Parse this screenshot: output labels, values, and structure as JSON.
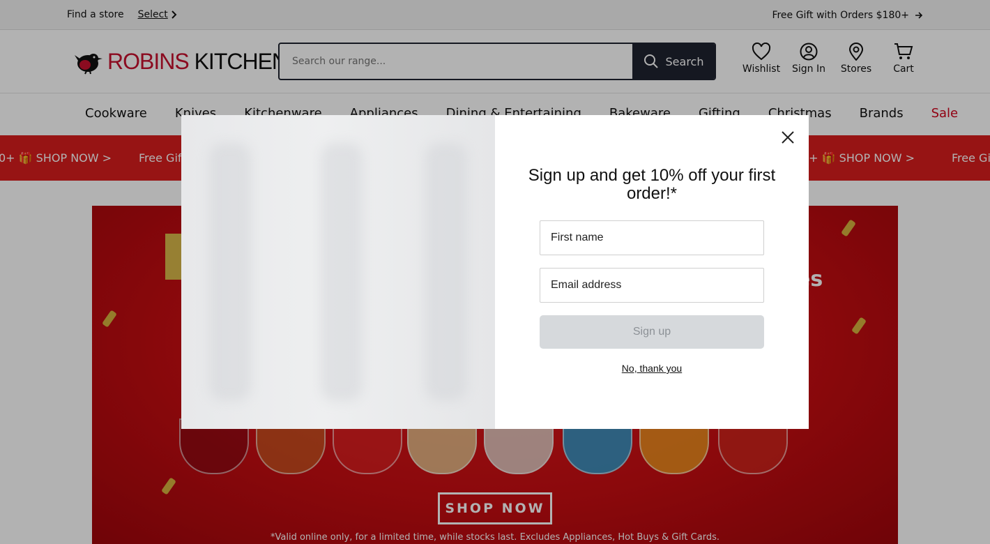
{
  "util_bar": {
    "find_store": "Find a store",
    "select_link": "Select",
    "promo": "Free Gift with Orders $180+"
  },
  "header": {
    "logo_red": "ROBINS",
    "logo_black": "KITCHEN",
    "search_placeholder": "Search our range...",
    "search_button": "Search",
    "icons": [
      {
        "label": "Wishlist",
        "icon": "heart-icon"
      },
      {
        "label": "Sign In",
        "icon": "user-icon"
      },
      {
        "label": "Stores",
        "icon": "map-pin-icon"
      },
      {
        "label": "Cart",
        "icon": "cart-icon"
      }
    ]
  },
  "nav": {
    "items": [
      "Cookware",
      "Knives",
      "Kitchenware",
      "Appliances",
      "Dining & Entertaining",
      "Bakeware",
      "Gifting",
      "Christmas",
      "Brands",
      "Sale"
    ]
  },
  "marquee": {
    "left_fragment": "0+ 🎁 SHOP NOW >",
    "mid_fragment": "Free Gift",
    "right_fragment_a": "0+ 🎁 SHOP NOW >",
    "right_fragment_b": "Free Gif"
  },
  "hero": {
    "right_fragment": "es",
    "cta": "SHOP NOW",
    "disclaimer": "*Valid online only, for a limited time, while stocks last. Excludes Appliances, Hot Buys & Gift Cards."
  },
  "modal": {
    "title": "Sign up and get 10% off your first order!*",
    "first_name_placeholder": "First name",
    "email_placeholder": "Email address",
    "signup_button": "Sign up",
    "decline_link": "No, thank you"
  },
  "colors": {
    "brand_red": "#c8102e",
    "sale_red": "#d0021b",
    "marquee_red": "#d81e1e",
    "search_dark": "#1f2330",
    "signup_disabled": "#d6d9dc"
  }
}
